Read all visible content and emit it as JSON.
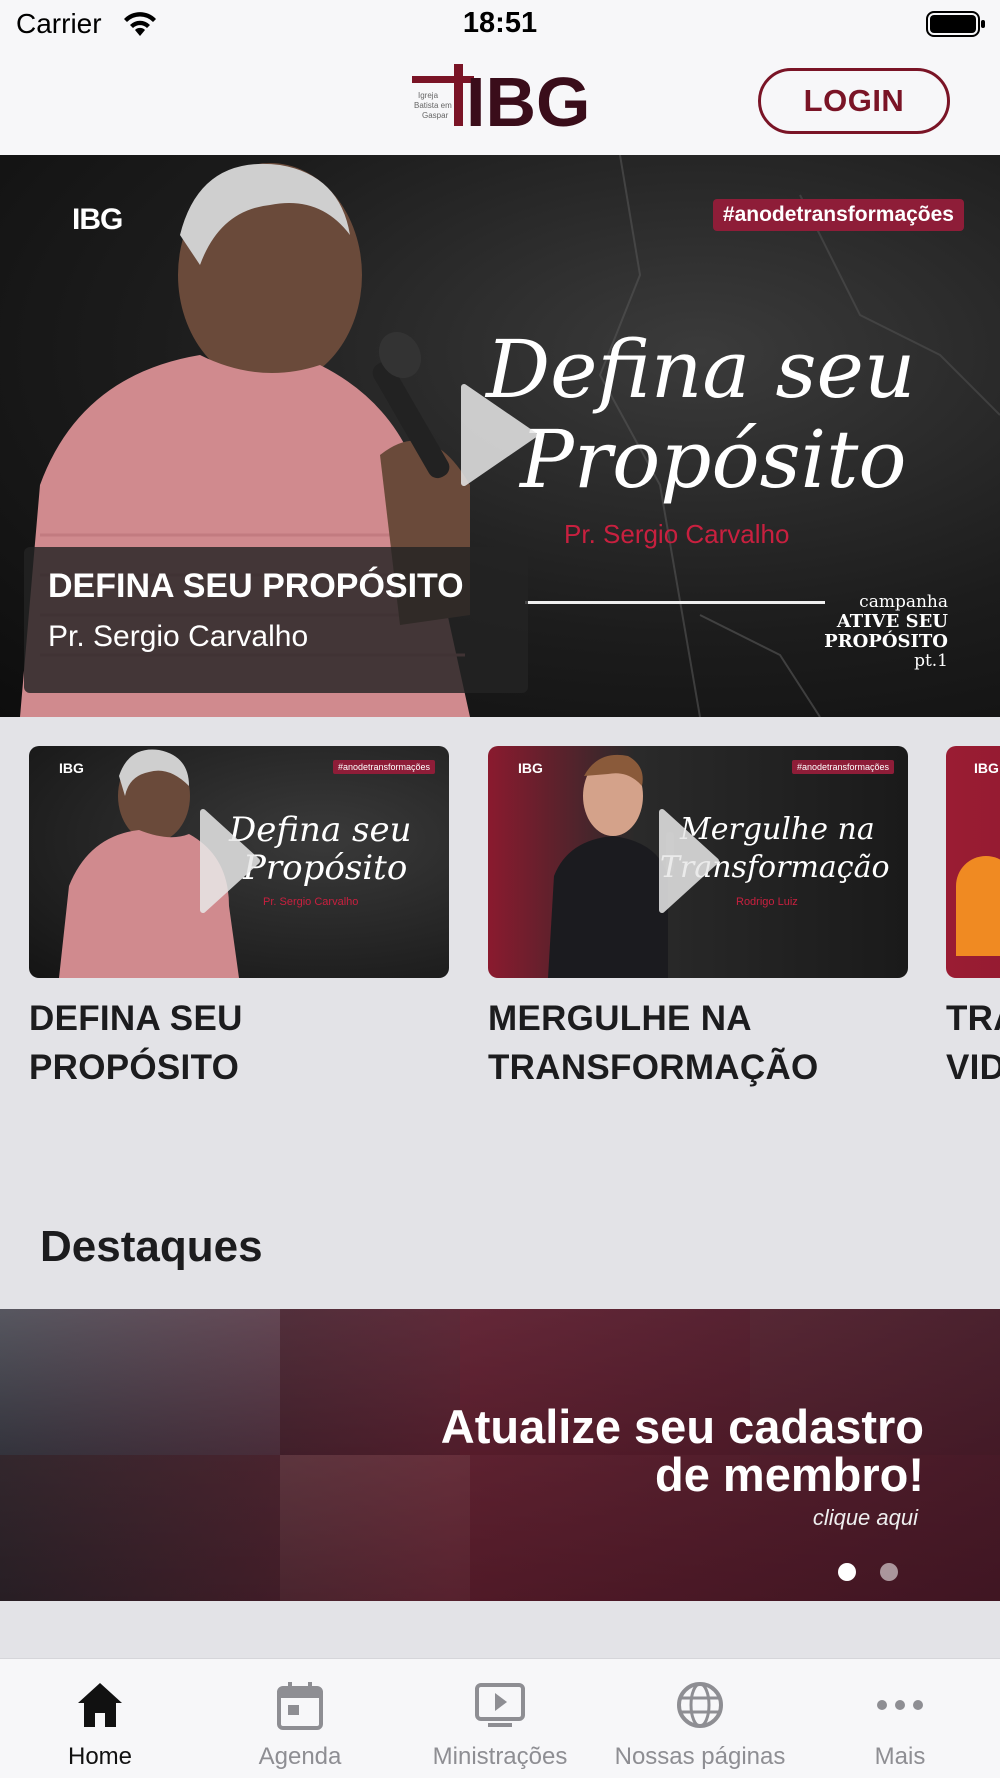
{
  "status_bar": {
    "carrier": "Carrier",
    "time": "18:51"
  },
  "header": {
    "logo_text": "IBG",
    "logo_small": [
      "Igreja",
      "Batista em",
      "Gaspar"
    ],
    "login_label": "LOGIN",
    "brand_color": "#7a1426"
  },
  "hero": {
    "small_logo": "IBG",
    "hashtag": "#anodetransformações",
    "script_line1": "Defina seu",
    "script_line2": "Propósito",
    "author_art": "Pr. Sergio Carvalho",
    "campaign": [
      "campanha",
      "ATIVE SEU",
      "PROPÓSITO",
      "pt.1"
    ],
    "caption_title": "DEFINA SEU PROPÓSITO",
    "caption_subtitle": "Pr. Sergio Carvalho"
  },
  "carousel": {
    "items": [
      {
        "title": "DEFINA SEU PROPÓSITO",
        "thumb_logo": "IBG",
        "thumb_tag": "#anodetransformações",
        "thumb_script1": "Defina seu",
        "thumb_script2": "Propósito",
        "thumb_author": "Pr. Sergio Carvalho"
      },
      {
        "title": "MERGULHE NA TRANSFORMAÇÃO",
        "thumb_logo": "IBG",
        "thumb_tag": "#anodetransformações",
        "thumb_script1": "Mergulhe na",
        "thumb_script2": "Transformação",
        "thumb_author": "Rodrigo Luiz"
      },
      {
        "title": "TRA VID",
        "thumb_logo": "IBG"
      }
    ]
  },
  "highlights": {
    "section_title": "Destaques",
    "banner_title_line1": "Atualize seu cadastro",
    "banner_title_line2": "de membro!",
    "banner_sub": "clique aqui",
    "active_slide": 1,
    "slide_count": 2
  },
  "tab_bar": {
    "tabs": [
      {
        "label": "Home",
        "icon": "home-icon",
        "active": true
      },
      {
        "label": "Agenda",
        "icon": "calendar-icon",
        "active": false
      },
      {
        "label": "Ministrações",
        "icon": "play-screen-icon",
        "active": false
      },
      {
        "label": "Nossas páginas",
        "icon": "globe-icon",
        "active": false
      },
      {
        "label": "Mais",
        "icon": "more-icon",
        "active": false
      }
    ]
  }
}
